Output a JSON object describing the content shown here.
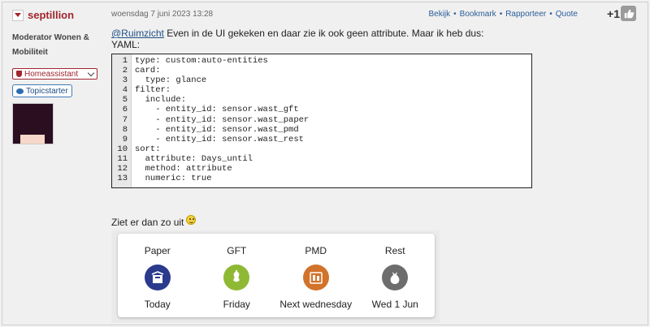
{
  "user": {
    "name": "septillion",
    "role": "Moderator Wonen & Mobiliteit",
    "group_badge": "Homeassistant",
    "topicstarter": "Topicstarter"
  },
  "post": {
    "date": "woensdag 7 juni 2023 13:28",
    "actions": [
      "Bekijk",
      "Bookmark",
      "Rapporteer",
      "Quote"
    ],
    "score": "+1",
    "mention": "@Ruimzicht",
    "text": " Even in de UI gekeken en daar zie ik ook geen attribute. Maar ik heb dus:",
    "yaml_label": "YAML:",
    "code_line_numbers": [
      "1",
      "2",
      "3",
      "4",
      "5",
      "6",
      "7",
      "8",
      "9",
      "10",
      "11",
      "12",
      "13"
    ],
    "code_lines": [
      "type: custom:auto-entities",
      "card:",
      "  type: glance",
      "filter:",
      "  include:",
      "    - entity_id: sensor.wast_gft",
      "    - entity_id: sensor.wast_paper",
      "    - entity_id: sensor.wast_pmd",
      "    - entity_id: sensor.wast_rest",
      "sort:",
      "  attribute: Days_until",
      "  method: attribute",
      "  numeric: true"
    ],
    "result_text": "Ziet er dan zo uit"
  },
  "glance": {
    "entities": [
      {
        "name": "Paper",
        "state": "Today",
        "icon": "paper-bin-icon",
        "color": "#2b3a8c"
      },
      {
        "name": "GFT",
        "state": "Friday",
        "icon": "organic-bin-icon",
        "color": "#8fb935"
      },
      {
        "name": "PMD",
        "state": "Next wednesday",
        "icon": "pmd-bin-icon",
        "color": "#d2732b"
      },
      {
        "name": "Rest",
        "state": "Wed 1 Jun",
        "icon": "rest-bag-icon",
        "color": "#6d6d6d"
      }
    ]
  },
  "colors": {
    "brand": "#a0262f",
    "link": "#2a5d9a"
  }
}
